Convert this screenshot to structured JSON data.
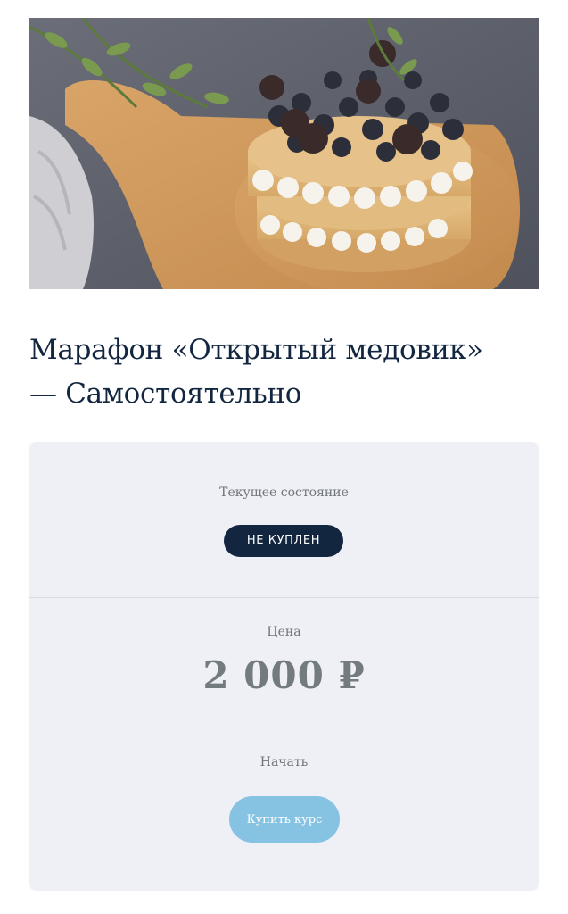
{
  "course": {
    "title_line1": "Марафон «Открытый медовик»",
    "title_line2": "— Самостоятельно"
  },
  "status": {
    "label": "Текущее состояние",
    "badge": "НЕ КУПЛЕН"
  },
  "price": {
    "label": "Цена",
    "value": "2 000 ₽"
  },
  "start": {
    "label": "Начать",
    "button": "Купить курс"
  },
  "colors": {
    "title": "#132640",
    "badge_bg": "#132640",
    "card_bg": "#eff0f5",
    "price": "#737b80",
    "button_bg": "#86c3e3"
  }
}
